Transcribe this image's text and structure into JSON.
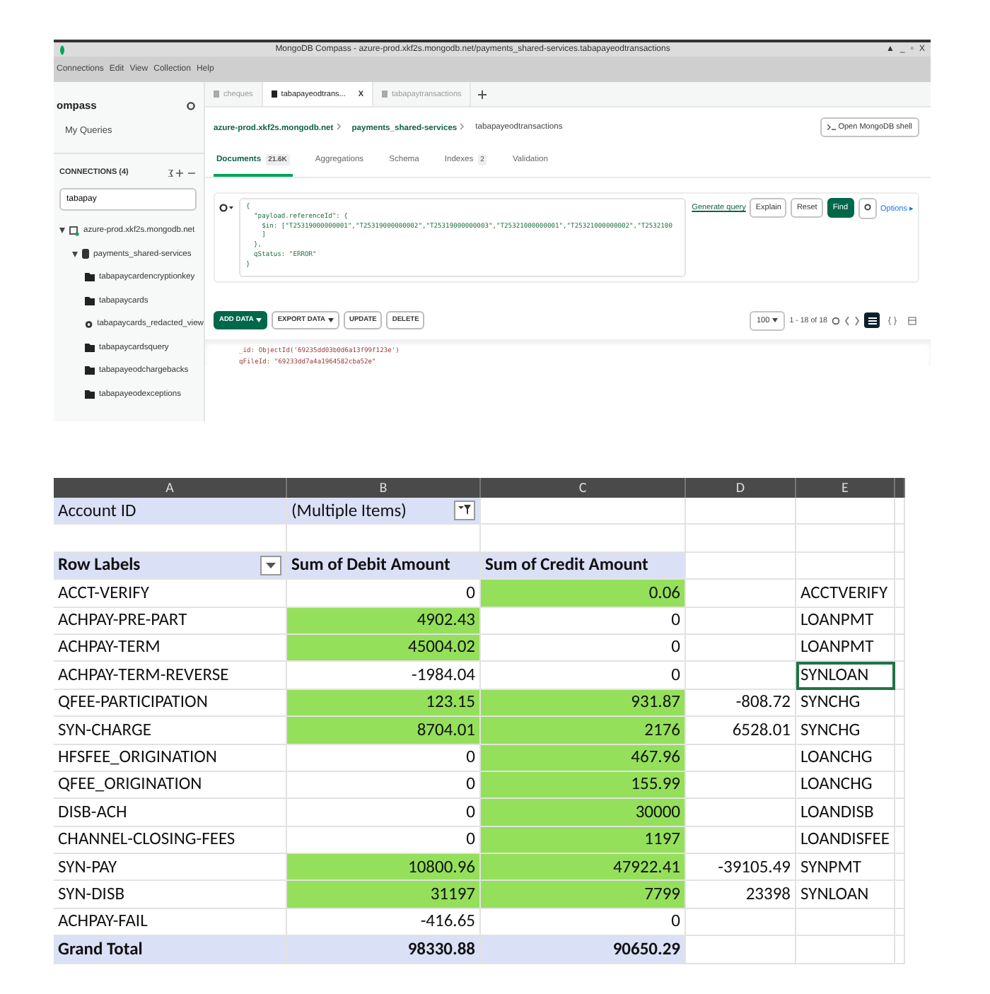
{
  "compass": {
    "window": {
      "title": "MongoDB Compass - azure-prod.xkf2s.mongodb.net/payments_shared-services.tabapayeodtransactions",
      "controls": [
        "▲",
        "_",
        "▫",
        "X"
      ]
    },
    "menu": [
      "Connections",
      "Edit",
      "View",
      "Collection",
      "Help"
    ],
    "sidebar": {
      "logo": "ompass",
      "my_queries": "My Queries",
      "connections_title": "CONNECTIONS (4)",
      "search": {
        "value": "tabapay"
      },
      "tree": [
        {
          "label": "azure-prod.xkf2s.mongodb.net",
          "kind": "connection",
          "expanded": true,
          "children": [
            {
              "label": "payments_shared-services",
              "kind": "database",
              "expanded": true,
              "children": [
                {
                  "label": "tabapaycardencryptionkey",
                  "kind": "collection"
                },
                {
                  "label": "tabapaycards",
                  "kind": "collection"
                },
                {
                  "label": "tabapaycards_redacted_view",
                  "kind": "view"
                },
                {
                  "label": "tabapaycardsquery",
                  "kind": "collection"
                },
                {
                  "label": "tabapayeodchargebacks",
                  "kind": "collection"
                },
                {
                  "label": "tabapayeodexceptions",
                  "kind": "collection"
                }
              ]
            }
          ]
        }
      ]
    },
    "tabs": [
      {
        "label": "cheques",
        "selected": false
      },
      {
        "label": "tabapayeodtrans...",
        "selected": true,
        "close": "X"
      },
      {
        "label": "tabapaytransactions",
        "selected": false
      }
    ],
    "breadcrumb": [
      "azure-prod.xkf2s.mongodb.net",
      "payments_shared-services",
      "tabapayeodtransactions"
    ],
    "shell_button": "Open MongoDB shell",
    "subtabs": [
      {
        "label": "Documents",
        "count": "21.6K",
        "selected": true
      },
      {
        "label": "Aggregations",
        "selected": false
      },
      {
        "label": "Schema",
        "selected": false
      },
      {
        "label": "Indexes",
        "count": "2",
        "selected": false
      },
      {
        "label": "Validation",
        "selected": false
      }
    ],
    "query": {
      "lines": [
        "{",
        "  \"payload.referenceId\": {",
        "    $in: [\"T25319000000001\",\"T25319000000002\",\"T25319000000003\",\"T25321000000001\",\"T25321000000002\",\"T2532100",
        "    ]",
        "  },",
        "  qStatus: \"ERROR\"",
        "}"
      ],
      "generate": "Generate query",
      "buttons": [
        "Explain",
        "Reset",
        "Find"
      ],
      "options": "Options ▸"
    },
    "toolbar": {
      "actions": [
        {
          "label": "ADD DATA",
          "kind": "primary"
        },
        {
          "label": "EXPORT DATA",
          "kind": "menu"
        },
        {
          "label": "UPDATE",
          "kind": "plain"
        },
        {
          "label": "DELETE",
          "kind": "plain"
        }
      ],
      "page_size": "100",
      "range": "1 - 18 of 18"
    },
    "documents": [
      "_id: ObjectId('69235dd03b0d6a13f99f123e')",
      "qFileId: \"69233dd7a4a1964582cba52e\""
    ]
  },
  "sheet": {
    "columns": [
      "A",
      "B",
      "C",
      "D",
      "E"
    ],
    "filter": {
      "label": "Account ID",
      "value": "(Multiple Items)"
    },
    "headers": [
      "Row Labels",
      "Sum of Debit Amount",
      "Sum of Credit Amount"
    ],
    "rows": [
      {
        "label": "ACCT-VERIFY",
        "debit": "0",
        "debit_marked": false,
        "credit": "0.06",
        "credit_marked": true,
        "col_d": "",
        "code": "ACCTVERIFY",
        "selected": false
      },
      {
        "label": "ACHPAY-PRE-PART",
        "debit": "4902.43",
        "debit_marked": true,
        "credit": "0",
        "credit_marked": false,
        "col_d": "",
        "code": "LOANPMT",
        "selected": false
      },
      {
        "label": "ACHPAY-TERM",
        "debit": "45004.02",
        "debit_marked": true,
        "credit": "0",
        "credit_marked": false,
        "col_d": "",
        "code": "LOANPMT",
        "selected": false
      },
      {
        "label": "ACHPAY-TERM-REVERSE",
        "debit": "-1984.04",
        "debit_marked": false,
        "credit": "0",
        "credit_marked": false,
        "col_d": "",
        "code": "SYNLOAN",
        "selected": true
      },
      {
        "label": "QFEE-PARTICIPATION",
        "debit": "123.15",
        "debit_marked": true,
        "credit": "931.87",
        "credit_marked": true,
        "col_d": "-808.72",
        "code": "SYNCHG",
        "selected": false
      },
      {
        "label": "SYN-CHARGE",
        "debit": "8704.01",
        "debit_marked": true,
        "credit": "2176",
        "credit_marked": true,
        "col_d": "6528.01",
        "code": "SYNCHG",
        "selected": false
      },
      {
        "label": "HFSFEE_ORIGINATION",
        "debit": "0",
        "debit_marked": false,
        "credit": "467.96",
        "credit_marked": true,
        "col_d": "",
        "code": "LOANCHG",
        "selected": false
      },
      {
        "label": "QFEE_ORIGINATION",
        "debit": "0",
        "debit_marked": false,
        "credit": "155.99",
        "credit_marked": true,
        "col_d": "",
        "code": "LOANCHG",
        "selected": false
      },
      {
        "label": "DISB-ACH",
        "debit": "0",
        "debit_marked": false,
        "credit": "30000",
        "credit_marked": true,
        "col_d": "",
        "code": "LOANDISB",
        "selected": false
      },
      {
        "label": "CHANNEL-CLOSING-FEES",
        "debit": "0",
        "debit_marked": false,
        "credit": "1197",
        "credit_marked": true,
        "col_d": "",
        "code": "LOANDISFEE",
        "selected": false
      },
      {
        "label": "SYN-PAY",
        "debit": "10800.96",
        "debit_marked": true,
        "credit": "47922.41",
        "credit_marked": true,
        "col_d": "-39105.49",
        "code": "SYNPMT",
        "selected": false
      },
      {
        "label": "SYN-DISB",
        "debit": "31197",
        "debit_marked": true,
        "credit": "7799",
        "credit_marked": true,
        "col_d": "23398",
        "code": "SYNLOAN",
        "selected": false
      },
      {
        "label": "ACHPAY-FAIL",
        "debit": "-416.65",
        "debit_marked": false,
        "credit": "0",
        "credit_marked": false,
        "col_d": "",
        "code": "",
        "selected": false
      }
    ],
    "total": {
      "label": "Grand Total",
      "debit": "98330.88",
      "credit": "90650.29"
    }
  }
}
